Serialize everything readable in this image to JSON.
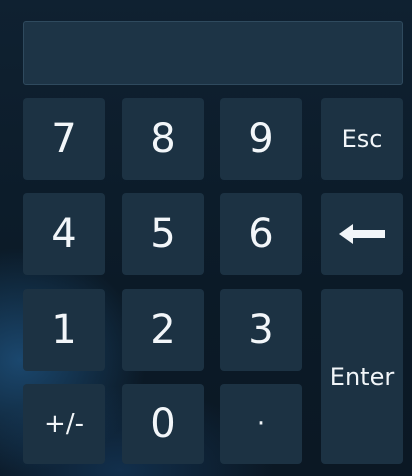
{
  "display": {
    "value": ""
  },
  "keys": {
    "k7": "7",
    "k8": "8",
    "k9": "9",
    "esc": "Esc",
    "k4": "4",
    "k5": "5",
    "k6": "6",
    "backspace": "←",
    "k1": "1",
    "k2": "2",
    "k3": "3",
    "enter": "Enter",
    "plusminus": "+/-",
    "k0": "0",
    "decimal": "·"
  },
  "colors": {
    "key_bg": "#1c3243",
    "display_bg": "#1d3446",
    "text": "#f2f6f9"
  }
}
